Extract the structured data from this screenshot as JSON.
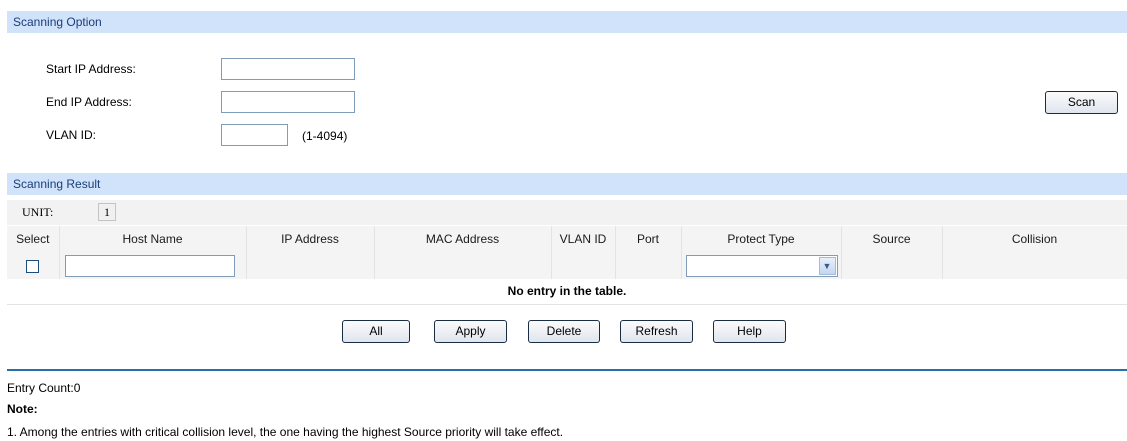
{
  "scanning_option": {
    "header": "Scanning Option",
    "start_ip_label": "Start IP Address:",
    "start_ip_value": "",
    "end_ip_label": "End IP Address:",
    "end_ip_value": "",
    "vlan_label": "VLAN ID:",
    "vlan_value": "",
    "vlan_hint": "(1-4094)",
    "scan_button": "Scan"
  },
  "scanning_result": {
    "header": "Scanning Result",
    "unit_label": "UNIT:",
    "unit_value": "1",
    "columns": [
      "Select",
      "Host Name",
      "IP Address",
      "MAC Address",
      "VLAN ID",
      "Port",
      "Protect Type",
      "Source",
      "Collision"
    ],
    "host_name_value": "",
    "protect_type_value": "",
    "empty_message": "No entry in the table."
  },
  "actions": {
    "all": "All",
    "apply": "Apply",
    "delete": "Delete",
    "refresh": "Refresh",
    "help": "Help"
  },
  "footer": {
    "entry_count": "Entry Count:0",
    "note_label": "Note:",
    "note_1": "1. Among the entries with critical collision level, the one having the highest Source priority will take effect."
  }
}
